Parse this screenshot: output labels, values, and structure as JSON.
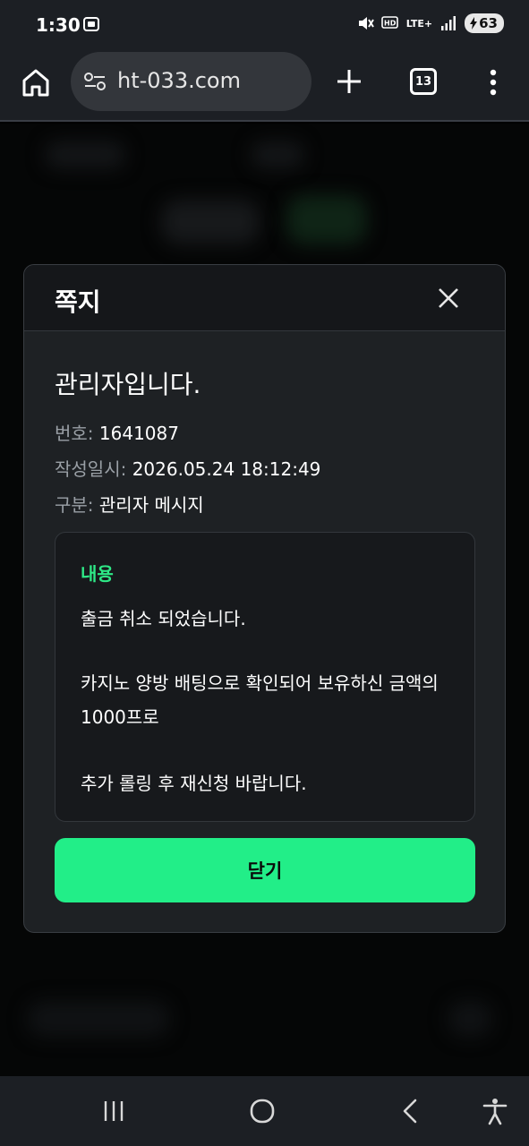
{
  "status_bar": {
    "time": "1:30",
    "network": "LTE+",
    "battery": "63",
    "icons": [
      "screen-capture-icon",
      "mute-icon",
      "hd-voice-icon",
      "signal-icon",
      "battery-charging-icon"
    ]
  },
  "browser": {
    "url": "ht-033.com",
    "tab_count": "13",
    "icons": [
      "home-icon",
      "site-settings-icon",
      "plus-icon",
      "more-vert-icon"
    ]
  },
  "modal": {
    "title": "쪽지",
    "message_title": "관리자입니다.",
    "meta": [
      {
        "key": "번호:",
        "value": "1641087"
      },
      {
        "key": "작성일시:",
        "value": "2026.05.24 18:12:49"
      },
      {
        "key": "구분:",
        "value": "관리자 메시지"
      }
    ],
    "content_label": "내용",
    "content_lines": [
      "출금 취소 되었습니다.",
      "카지노 양방 배팅으로 확인되어 보유하신 금액의",
      "1000프로",
      "추가 롤링 후 재신청 바랍니다."
    ],
    "close_button": "닫기",
    "accent_color": "#22ee88"
  },
  "nav_bar": {
    "icons": [
      "recents-icon",
      "home-circle-icon",
      "back-icon",
      "accessibility-icon"
    ]
  }
}
